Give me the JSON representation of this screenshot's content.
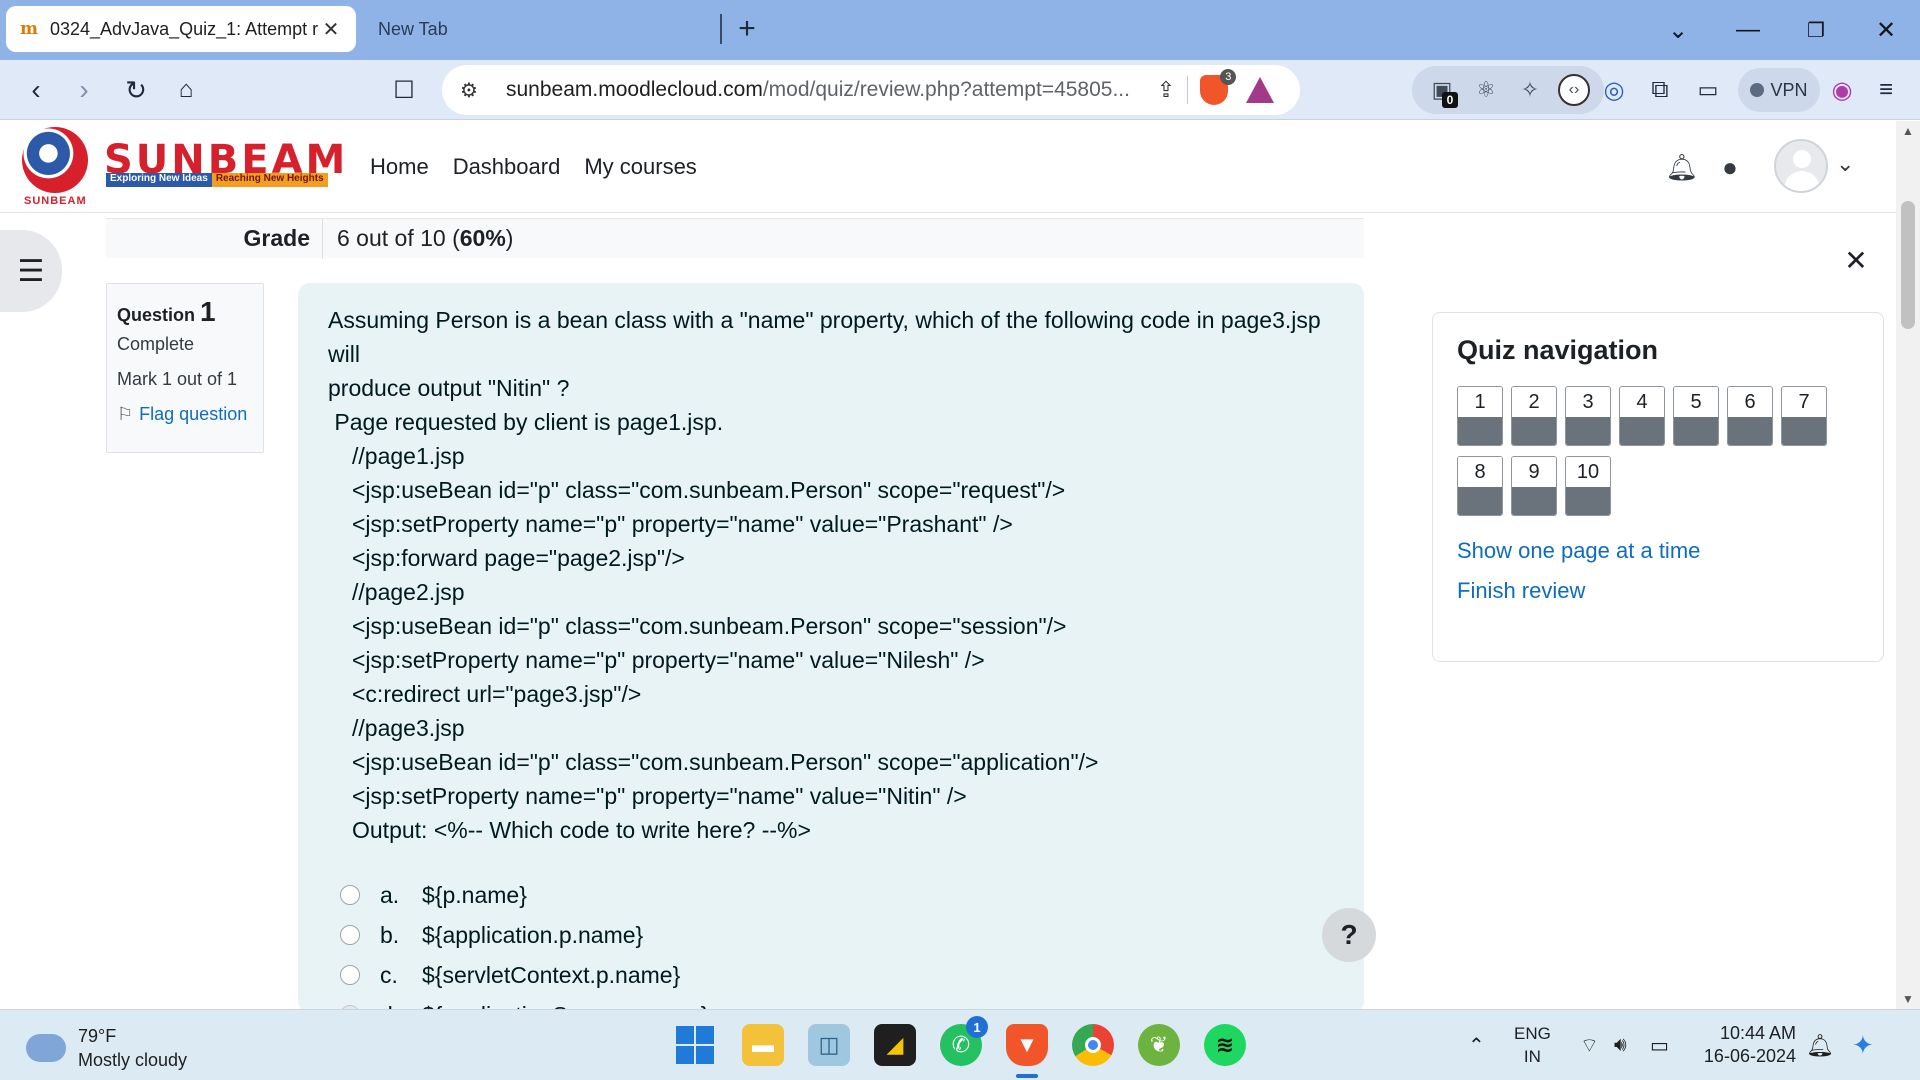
{
  "browser": {
    "active_tab_title": "0324_AdvJava_Quiz_1: Attempt r",
    "inactive_tab_title": "New Tab",
    "url_host": "sunbeam.moodlecloud.com",
    "url_path": "/mod/quiz/review.php?attempt=45805...",
    "brave_shield_count": "3",
    "ext_wallet_count": "0",
    "vpn_label": "VPN"
  },
  "site": {
    "logo_word": "SUNBEAM",
    "logo_tag_1": "Exploring New Ideas",
    "logo_tag_2": "Reaching New Heights",
    "logo_small": "SUNBEAM",
    "nav": [
      "Home",
      "Dashboard",
      "My courses"
    ]
  },
  "grade": {
    "label": "Grade",
    "value_prefix": "6 out of 10 (",
    "value_bold": "60%",
    "value_suffix": ")"
  },
  "question_info": {
    "label": "Question",
    "number": "1",
    "state": "Complete",
    "mark": "Mark 1 out of 1",
    "flag_label": "Flag question"
  },
  "question": {
    "text_lines": [
      "Assuming Person is a bean class with a \"name\" property, which of the following code in page3.jsp will",
      "produce output \"Nitin\" ?",
      " Page requested by client is page1.jsp."
    ],
    "code_lines": [
      "//page1.jsp",
      "<jsp:useBean id=\"p\" class=\"com.sunbeam.Person\" scope=\"request\"/>",
      "<jsp:setProperty name=\"p\" property=\"name\" value=\"Prashant\" />",
      "<jsp:forward page=\"page2.jsp\"/>",
      "//page2.jsp",
      "<jsp:useBean id=\"p\" class=\"com.sunbeam.Person\" scope=\"session\"/>",
      "<jsp:setProperty name=\"p\" property=\"name\" value=\"Nilesh\" />",
      "<c:redirect url=\"page3.jsp\"/>",
      "//page3.jsp",
      "<jsp:useBean id=\"p\" class=\"com.sunbeam.Person\" scope=\"application\"/>",
      "<jsp:setProperty name=\"p\" property=\"name\" value=\"Nitin\" />",
      "Output: <%-- Which code to write here? --%>"
    ],
    "answers": [
      {
        "letter": "a.",
        "text": "${p.name}",
        "selected": false
      },
      {
        "letter": "b.",
        "text": "${application.p.name}",
        "selected": false
      },
      {
        "letter": "c.",
        "text": "${servletContext.p.name}",
        "selected": false
      },
      {
        "letter": "d.",
        "text": "${applicationScope.p.name}",
        "selected": true
      }
    ]
  },
  "help_label": "?",
  "quiz_nav": {
    "title": "Quiz navigation",
    "buttons": [
      "1",
      "2",
      "3",
      "4",
      "5",
      "6",
      "7",
      "8",
      "9",
      "10"
    ],
    "link_one_page": "Show one page at a time",
    "link_finish": "Finish review"
  },
  "taskbar": {
    "temperature": "79°F",
    "weather": "Mostly cloudy",
    "whatsapp_badge": "1",
    "lang_1": "ENG",
    "lang_2": "IN",
    "time": "10:44 AM",
    "date": "16-06-2024"
  },
  "colors": {
    "tab_strip": "#8fb3e6",
    "question_bg": "#e7f3f5",
    "link": "#0f6cbf",
    "brand_red": "#d6202c"
  }
}
